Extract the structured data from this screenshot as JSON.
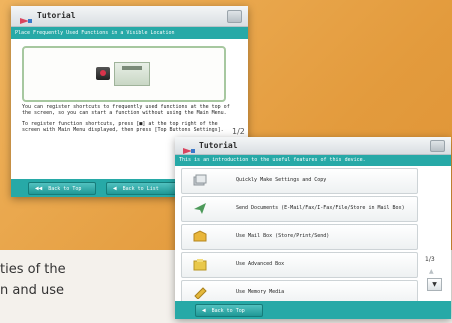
{
  "background": {
    "text_fragment_1": "ties of the",
    "text_fragment_2": "n and use"
  },
  "window_a": {
    "title": "Tutorial",
    "subtitle": "Place Frequently Used Functions in a Visible Location",
    "description_1": "You can register shortcuts to frequently used functions at the top of the screen, so you can start a function without using the Main Menu.",
    "description_2": "To register function shortcuts, press [■] at the top right of the screen with Main Menu displayed, then press [Top Buttons Settings].",
    "page_indicator": "1/2",
    "back_to_top": "Back to Top",
    "back_to_list": "Back to List"
  },
  "window_b": {
    "title": "Tutorial",
    "subtitle": "This is an introduction to the useful features of this device.",
    "items": [
      {
        "label": "Quickly Make Settings and Copy",
        "icon": "copy-settings-icon",
        "color": "#9aa2a8"
      },
      {
        "label": "Send Documents (E-Mail/Fax/I-Fax/File/Store in Mail Box)",
        "icon": "send-icon",
        "color": "#4d9a5a"
      },
      {
        "label": "Use Mail Box (Store/Print/Send)",
        "icon": "mailbox-icon",
        "color": "#e9b63a"
      },
      {
        "label": "Use Advanced Box",
        "icon": "advanced-box-icon",
        "color": "#e9c84a"
      },
      {
        "label": "Use Memory Media",
        "icon": "memory-media-icon",
        "color": "#e4b83c"
      }
    ],
    "page_indicator": "1/3",
    "back_to_top": "Back to Top"
  },
  "colors": {
    "teal": "#27a9a7",
    "background_orange": "#e9a64c"
  }
}
